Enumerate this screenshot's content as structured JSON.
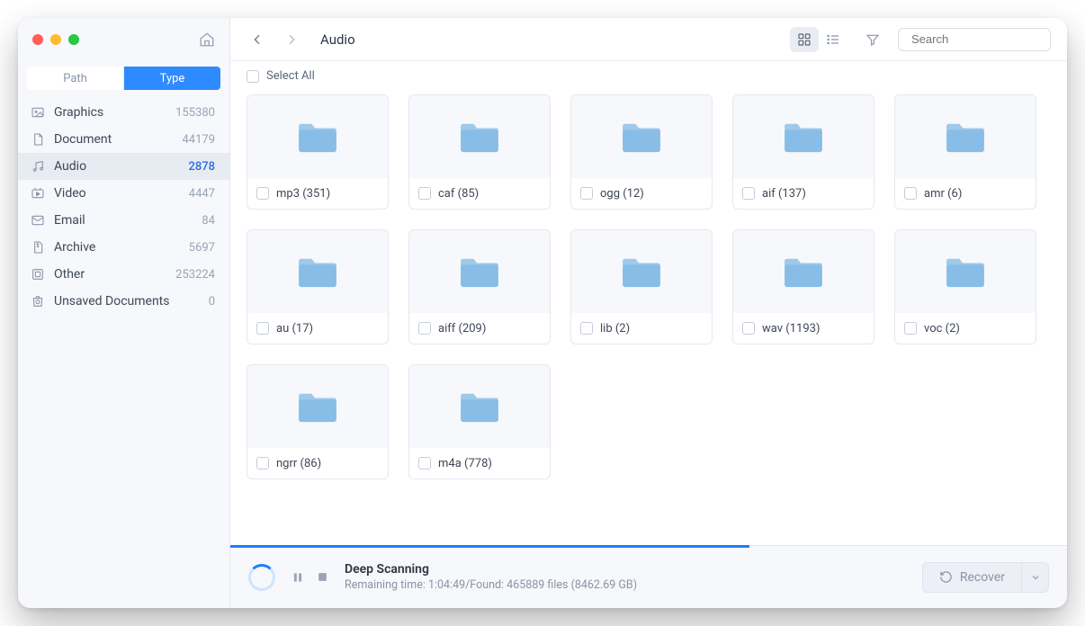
{
  "tabs": {
    "path": "Path",
    "type": "Type",
    "active": "type"
  },
  "sidebar": {
    "categories": [
      {
        "label": "Graphics",
        "count": "155380",
        "icon": "image"
      },
      {
        "label": "Document",
        "count": "44179",
        "icon": "document"
      },
      {
        "label": "Audio",
        "count": "2878",
        "icon": "audio",
        "active": true
      },
      {
        "label": "Video",
        "count": "4447",
        "icon": "video"
      },
      {
        "label": "Email",
        "count": "84",
        "icon": "email"
      },
      {
        "label": "Archive",
        "count": "5697",
        "icon": "archive"
      },
      {
        "label": "Other",
        "count": "253224",
        "icon": "other"
      },
      {
        "label": "Unsaved Documents",
        "count": "0",
        "icon": "unsaved"
      }
    ]
  },
  "breadcrumb": {
    "title": "Audio"
  },
  "search": {
    "placeholder": "Search"
  },
  "select_all_label": "Select All",
  "folders": [
    {
      "label": "mp3 (351)"
    },
    {
      "label": "caf (85)"
    },
    {
      "label": "ogg (12)"
    },
    {
      "label": "aif (137)"
    },
    {
      "label": "amr (6)"
    },
    {
      "label": "au (17)"
    },
    {
      "label": "aiff (209)"
    },
    {
      "label": "lib (2)"
    },
    {
      "label": "wav (1193)"
    },
    {
      "label": "voc (2)"
    },
    {
      "label": "ngrr (86)"
    },
    {
      "label": "m4a (778)"
    }
  ],
  "scan": {
    "title": "Deep Scanning",
    "subtitle": "Remaining time: 1:04:49/Found: 465889 files (8462.69 GB)",
    "progress_percent": 62
  },
  "recover_label": "Recover"
}
